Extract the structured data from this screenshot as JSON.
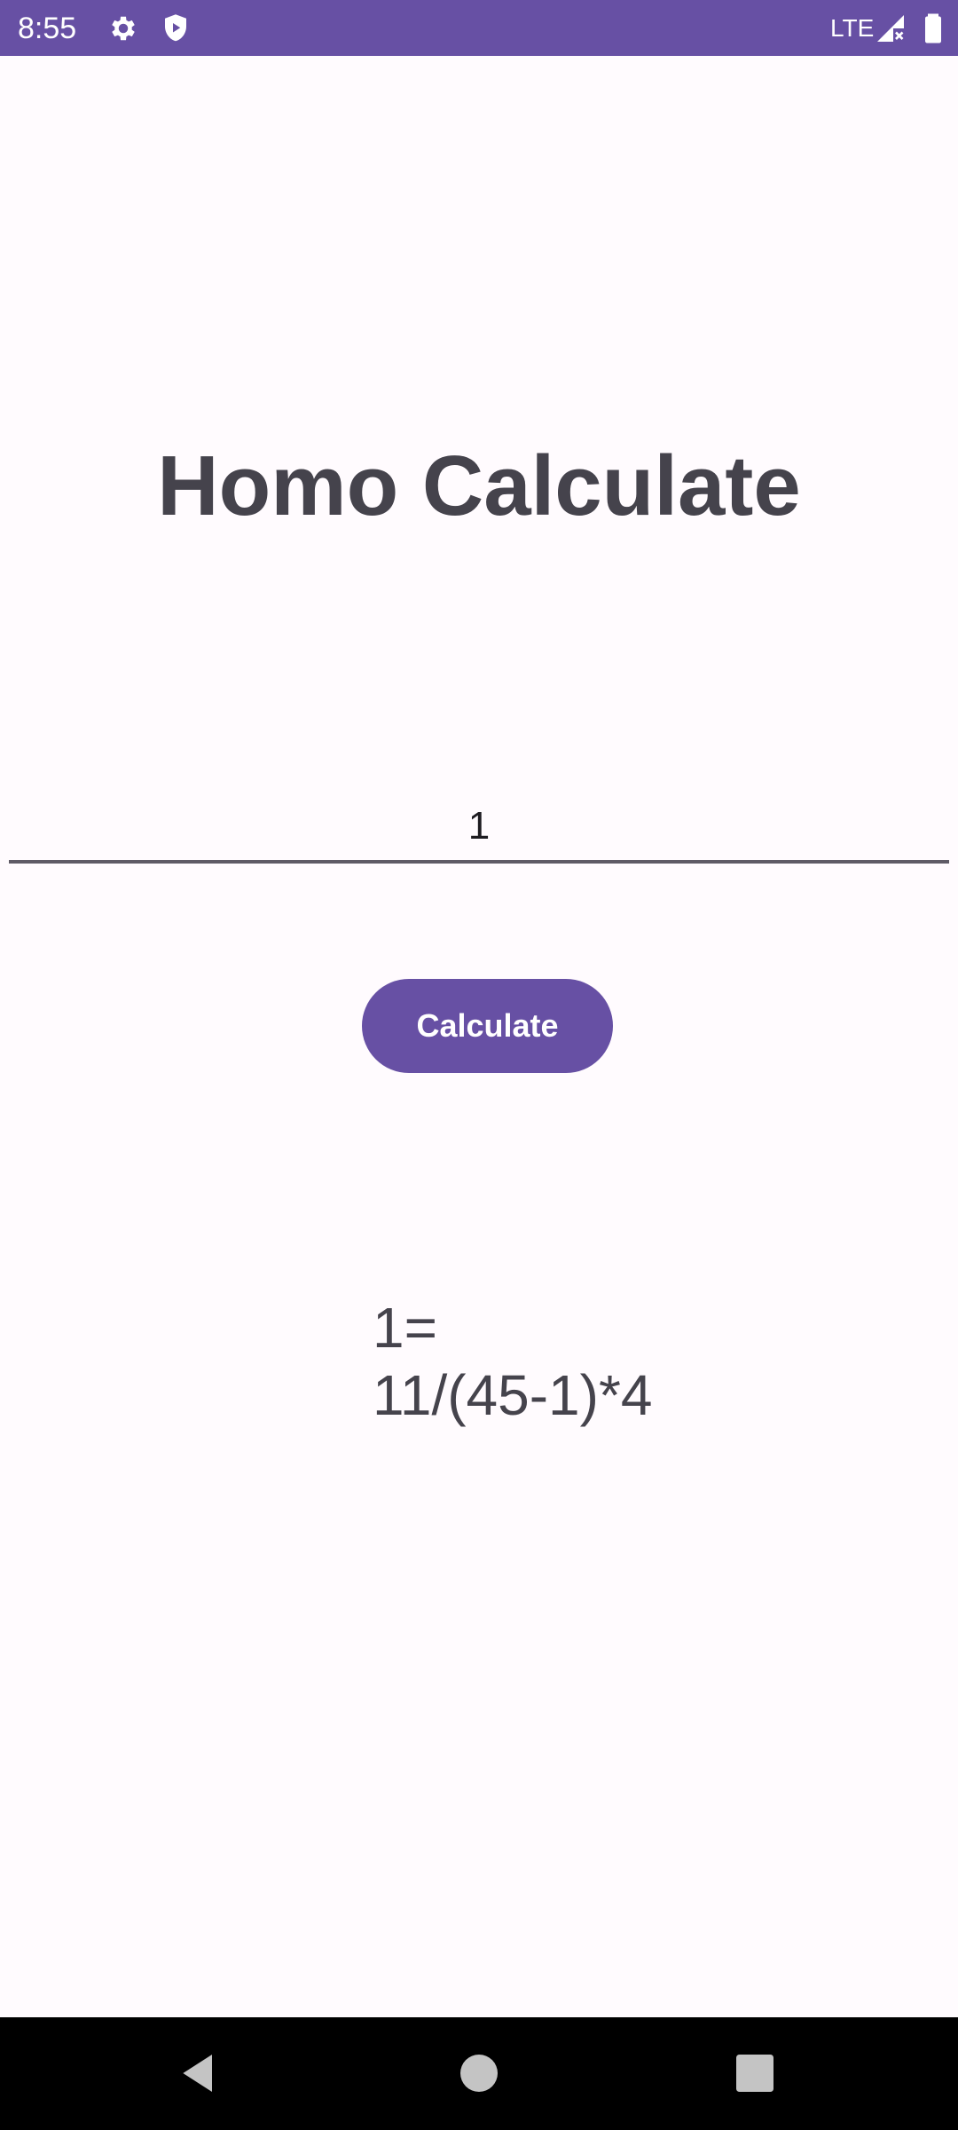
{
  "status_bar": {
    "time": "8:55",
    "network": "LTE",
    "icons": [
      "gear-icon",
      "shield-play-icon",
      "signal-icon",
      "battery-icon"
    ]
  },
  "app": {
    "title": "Homo Calculate",
    "input_value": "1",
    "button_label": "Calculate",
    "result_text": "1=\n11/(45-1)*4"
  },
  "colors": {
    "primary": "#6750a4",
    "background": "#fffbfe",
    "text": "#45434c"
  },
  "nav_bar": {
    "buttons": [
      "back-icon",
      "home-icon",
      "recents-icon"
    ]
  }
}
